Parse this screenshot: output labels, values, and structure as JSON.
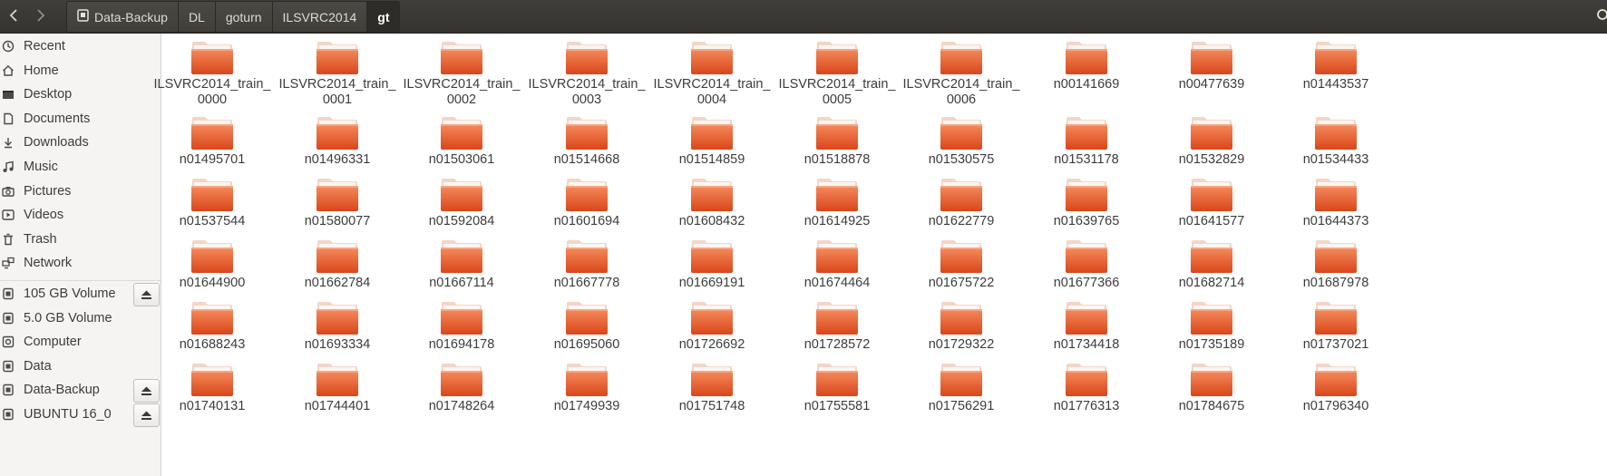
{
  "breadcrumb": {
    "items": [
      "Data-Backup",
      "DL",
      "goturn",
      "ILSVRC2014",
      "gt"
    ],
    "active_index": 4
  },
  "sidebar": {
    "places": [
      {
        "label": "Recent",
        "icon": "clock-icon"
      },
      {
        "label": "Home",
        "icon": "home-icon"
      },
      {
        "label": "Desktop",
        "icon": "desktop-icon"
      },
      {
        "label": "Documents",
        "icon": "document-icon"
      },
      {
        "label": "Downloads",
        "icon": "download-icon"
      },
      {
        "label": "Music",
        "icon": "music-icon"
      },
      {
        "label": "Pictures",
        "icon": "camera-icon"
      },
      {
        "label": "Videos",
        "icon": "video-icon"
      },
      {
        "label": "Trash",
        "icon": "trash-icon"
      },
      {
        "label": "Network",
        "icon": "network-icon"
      }
    ],
    "devices": [
      {
        "label": "105 GB Volume",
        "icon": "drive-icon",
        "eject": true
      },
      {
        "label": "5.0 GB Volume",
        "icon": "drive-icon",
        "eject": false
      },
      {
        "label": "Computer",
        "icon": "computer-icon",
        "eject": false
      },
      {
        "label": "Data",
        "icon": "drive-icon",
        "eject": false
      },
      {
        "label": "Data-Backup",
        "icon": "drive-icon",
        "eject": true
      },
      {
        "label": "UBUNTU 16_0",
        "icon": "drive-icon",
        "eject": true
      }
    ]
  },
  "files": [
    "ILSVRC2014_train_0000",
    "ILSVRC2014_train_0001",
    "ILSVRC2014_train_0002",
    "ILSVRC2014_train_0003",
    "ILSVRC2014_train_0004",
    "ILSVRC2014_train_0005",
    "ILSVRC2014_train_0006",
    "n00141669",
    "n00477639",
    "n01443537",
    "n01495701",
    "n01496331",
    "n01503061",
    "n01514668",
    "n01514859",
    "n01518878",
    "n01530575",
    "n01531178",
    "n01532829",
    "n01534433",
    "n01537544",
    "n01580077",
    "n01592084",
    "n01601694",
    "n01608432",
    "n01614925",
    "n01622779",
    "n01639765",
    "n01641577",
    "n01644373",
    "n01644900",
    "n01662784",
    "n01667114",
    "n01667778",
    "n01669191",
    "n01674464",
    "n01675722",
    "n01677366",
    "n01682714",
    "n01687978",
    "n01688243",
    "n01693334",
    "n01694178",
    "n01695060",
    "n01726692",
    "n01728572",
    "n01729322",
    "n01734418",
    "n01735189",
    "n01737021",
    "n01740131",
    "n01744401",
    "n01748264",
    "n01749939",
    "n01751748",
    "n01755581",
    "n01756291",
    "n01776313",
    "n01784675",
    "n01796340"
  ],
  "colors": {
    "folder_top": "#f58a5c",
    "folder_bottom": "#d9461a",
    "folder_tab": "#f2d6c8"
  }
}
